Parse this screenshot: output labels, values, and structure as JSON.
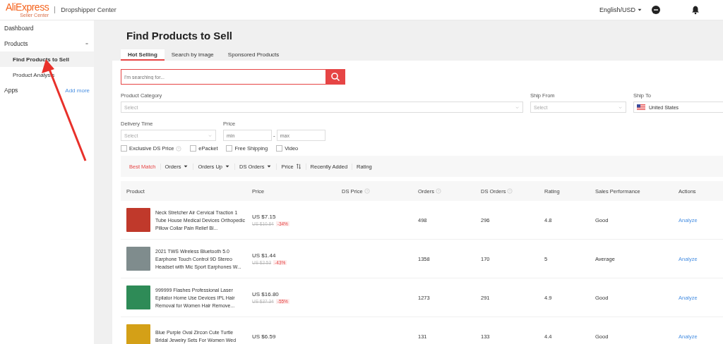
{
  "header": {
    "logo": "AliExpress",
    "logo_sub": "Seller Center",
    "app_title": "Dropshipper Center",
    "language": "English/USD"
  },
  "sidebar": {
    "items": [
      {
        "label": "Dashboard",
        "selected": false
      },
      {
        "label": "Products",
        "selected": false,
        "expanded": true,
        "children": [
          {
            "label": "Find Products to Sell",
            "selected": true
          },
          {
            "label": "Product Analysis",
            "selected": false
          }
        ]
      },
      {
        "label": "Apps",
        "selected": false,
        "link": "Add more"
      }
    ]
  },
  "page_title": "Find Products to Sell",
  "tabs": [
    {
      "label": "Hot Selling",
      "selected": true
    },
    {
      "label": "Search by image",
      "selected": false
    },
    {
      "label": "Sponsored Products",
      "selected": false
    }
  ],
  "search": {
    "placeholder": "I'm searching for..."
  },
  "filters": {
    "product_category": {
      "label": "Product Category",
      "placeholder": "Select"
    },
    "ship_from": {
      "label": "Ship From",
      "placeholder": "Select"
    },
    "ship_to": {
      "label": "Ship To",
      "value": "United States"
    },
    "delivery_time": {
      "label": "Delivery Time",
      "placeholder": "Select"
    },
    "price": {
      "label": "Price",
      "min_placeholder": "min",
      "separator": "-",
      "max_placeholder": "max"
    }
  },
  "checkboxes": [
    {
      "label": "Exclusive DS Price",
      "checked": false,
      "help": true
    },
    {
      "label": "ePacket",
      "checked": false,
      "help": false
    },
    {
      "label": "Free Shipping",
      "checked": false,
      "help": false
    },
    {
      "label": "Video",
      "checked": false,
      "help": false
    }
  ],
  "sort_options": [
    {
      "label": "Best Match",
      "selected": true,
      "kind": "plain"
    },
    {
      "label": "Orders",
      "selected": false,
      "kind": "caret"
    },
    {
      "label": "Orders Up",
      "selected": false,
      "kind": "caret"
    },
    {
      "label": "DS Orders",
      "selected": false,
      "kind": "caret"
    },
    {
      "label": "Price",
      "selected": false,
      "kind": "updown"
    },
    {
      "label": "Recently Added",
      "selected": false,
      "kind": "plain"
    },
    {
      "label": "Rating",
      "selected": false,
      "kind": "plain"
    }
  ],
  "table": {
    "columns": [
      {
        "label": "Product",
        "help": false
      },
      {
        "label": "Price",
        "help": false
      },
      {
        "label": "DS Price",
        "help": true
      },
      {
        "label": "Orders",
        "help": true
      },
      {
        "label": "DS Orders",
        "help": true
      },
      {
        "label": "Rating",
        "help": false
      },
      {
        "label": "Sales Performance",
        "help": false
      },
      {
        "label": "Actions",
        "help": false
      }
    ],
    "rows": [
      {
        "title": "Neck Stretcher Air Cervical Traction 1 Tube House Medical Devices Orthopedic Pillow Collar Pain Relief Bl...",
        "price": "US $7.15",
        "old_price": "US $10.84",
        "discount": "-34%",
        "orders": "498",
        "ds_orders": "296",
        "rating": "4.8",
        "performance": "Good",
        "action": "Analyze"
      },
      {
        "title": "2021 TWS Wireless Bluetooth 5.0 Earphone Touch Control 9D Stereo Headset with Mic Sport Earphones W...",
        "price": "US $1.44",
        "old_price": "US $2.53",
        "discount": "-43%",
        "orders": "1358",
        "ds_orders": "170",
        "rating": "5",
        "performance": "Average",
        "action": "Analyze"
      },
      {
        "title": "999999 Flashes Professional Laser Epilator Home Use Devices IPL Hair Removal for Women Hair Remove...",
        "price": "US $16.80",
        "old_price": "US $37.34",
        "discount": "-55%",
        "orders": "1273",
        "ds_orders": "291",
        "rating": "4.9",
        "performance": "Good",
        "action": "Analyze"
      },
      {
        "title": "Blue Purple Oval Zircon Cute Turtle Bridal Jewelry Sets For Women Wed",
        "price": "US $6.59",
        "orders": "131",
        "ds_orders": "133",
        "rating": "4.4",
        "performance": "Good",
        "action": "Analyze"
      }
    ]
  }
}
